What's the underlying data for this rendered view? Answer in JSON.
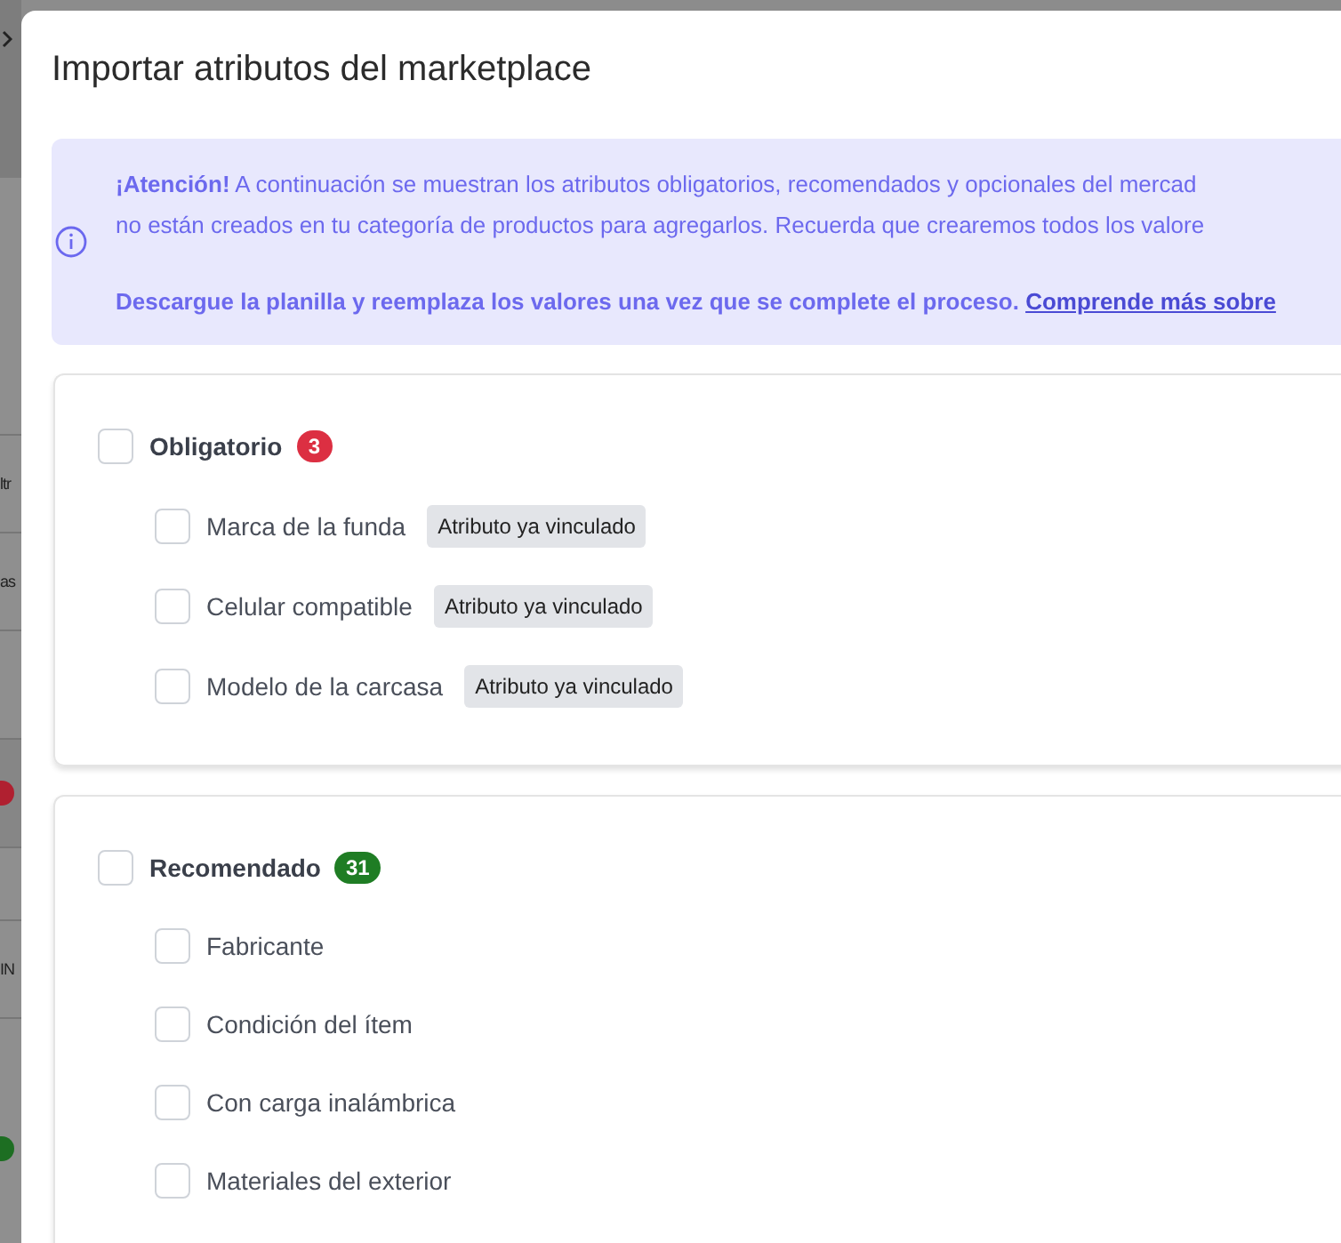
{
  "background": {
    "texts": [
      "ltr",
      "as",
      "IN"
    ]
  },
  "dialog": {
    "title": "Importar atributos del marketplace",
    "alert": {
      "lines": [
        "**¡Atención!** A continuación se muestran los atributos obligatorios, recomendados y opcionales del mercad",
        "no están creados en tu categoría de productos para agregarlos. Recuerda que crearemos todos los valore"
      ],
      "note": "Descargue la planilla y reemplaza los valores una vez que se complete el proceso.",
      "link": "Comprende más sobre"
    },
    "groups": [
      {
        "label": "Obligatorio",
        "count": "3",
        "color": "#dc2f42",
        "checked": false,
        "items": [
          {
            "label": "Marca de la funda",
            "checked": false,
            "tag": "Atributo ya vinculado"
          },
          {
            "label": "Celular compatible",
            "checked": false,
            "tag": "Atributo ya vinculado"
          },
          {
            "label": "Modelo de la carcasa",
            "checked": false,
            "tag": "Atributo ya vinculado"
          }
        ]
      },
      {
        "label": "Recomendado",
        "count": "31",
        "color": "#1f7d24",
        "checked": false,
        "items": [
          {
            "label": "Fabricante",
            "checked": false
          },
          {
            "label": "Condición del ítem",
            "checked": false
          },
          {
            "label": "Con carga inalámbrica",
            "checked": false
          },
          {
            "label": "Materiales del exterior",
            "checked": false
          }
        ]
      }
    ]
  }
}
